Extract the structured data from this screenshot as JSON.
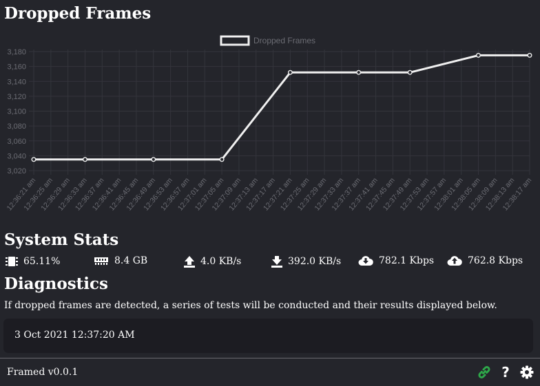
{
  "page_title": "Dropped Frames",
  "chart_data": {
    "type": "line",
    "legend": "Dropped Frames",
    "legend_position": "top-center",
    "grid": true,
    "ylim": [
      3020,
      3180
    ],
    "yticks": [
      "3,020",
      "3,040",
      "3,060",
      "3,080",
      "3,100",
      "3,120",
      "3,140",
      "3,160",
      "3,180"
    ],
    "categories": [
      "12:36:21 am",
      "12:36:25 am",
      "12:36:29 am",
      "12:36:33 am",
      "12:36:37 am",
      "12:36:41 am",
      "12:36:45 am",
      "12:36:49 am",
      "12:36:53 am",
      "12:36:57 am",
      "12:37:01 am",
      "12:37:05 am",
      "12:37:09 am",
      "12:37:13 am",
      "12:37:17 am",
      "12:37:21 am",
      "12:37:25 am",
      "12:37:29 am",
      "12:37:33 am",
      "12:37:37 am",
      "12:37:41 am",
      "12:37:45 am",
      "12:37:49 am",
      "12:37:53 am",
      "12:37:57 am",
      "12:38:01 am",
      "12:38:05 am",
      "12:38:09 am",
      "12:38:13 am",
      "12:38:17 am"
    ],
    "series": [
      {
        "name": "Dropped Frames",
        "color": "#f0f0f0",
        "points": [
          {
            "x": "12:36:21 am",
            "y": 3035
          },
          {
            "x": "12:36:33 am",
            "y": 3035
          },
          {
            "x": "12:36:49 am",
            "y": 3035
          },
          {
            "x": "12:37:05 am",
            "y": 3035
          },
          {
            "x": "12:37:21 am",
            "y": 3152
          },
          {
            "x": "12:37:37 am",
            "y": 3152
          },
          {
            "x": "12:37:49 am",
            "y": 3152
          },
          {
            "x": "12:38:05 am",
            "y": 3175
          },
          {
            "x": "12:38:17 am",
            "y": 3175
          }
        ]
      }
    ]
  },
  "system_stats": {
    "title": "System Stats",
    "items": [
      {
        "icon": "cpu-icon",
        "value": "65.11%"
      },
      {
        "icon": "memory-icon",
        "value": "8.4 GB"
      },
      {
        "icon": "upload-icon",
        "value": "4.0 KB/s"
      },
      {
        "icon": "download-icon",
        "value": "392.0 KB/s"
      },
      {
        "icon": "cloud-download-icon",
        "value": "782.1 Kbps"
      },
      {
        "icon": "cloud-upload-icon",
        "value": "762.8 Kbps"
      }
    ]
  },
  "diagnostics": {
    "title": "Diagnostics",
    "description": "If dropped frames are detected, a series of tests will be conducted and their results displayed below.",
    "results": [
      {
        "timestamp": "3 Oct 2021 12:37:20 AM"
      }
    ]
  },
  "footer": {
    "version": "Framed v0.0.1",
    "help_symbol": "?",
    "link_icon_color": "#2ea84a"
  },
  "colors": {
    "background": "#24252b",
    "grid": "#34353c",
    "axis_text": "#6c6d74",
    "line": "#f0f0f0",
    "panel": "#1c1c22"
  }
}
